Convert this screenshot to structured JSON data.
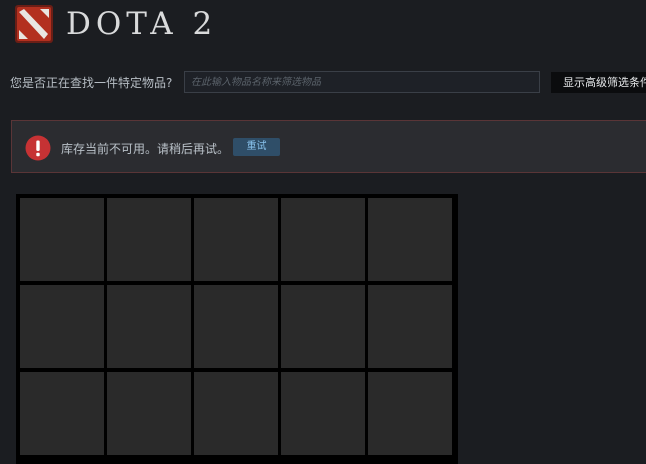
{
  "header": {
    "game_title": "DOTA 2",
    "logo_icon": "dota2-logo-icon"
  },
  "search": {
    "label": "您是否正在查找一件特定物品?",
    "placeholder": "在此输入物品名称来筛选物品",
    "value": "",
    "advanced_button_label": "显示高级筛选条件"
  },
  "error": {
    "icon": "exclamation-icon",
    "message": "库存当前不可用。请稍后再试。",
    "retry_label": "重试"
  },
  "inventory": {
    "slot_count": 15,
    "columns": 5
  },
  "colors": {
    "background": "#1b1d21",
    "slot": "#2a2a2a",
    "grid_border": "#000000",
    "error_red": "#c63234",
    "retry_bg": "#2f4e68",
    "retry_text": "#88c2ec"
  }
}
